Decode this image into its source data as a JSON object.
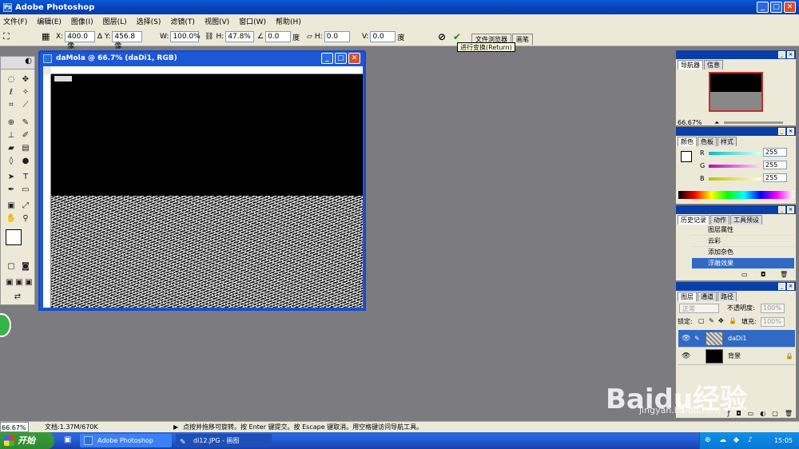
{
  "app": {
    "title": "Adobe Photoshop"
  },
  "menu": [
    "文件(F)",
    "编辑(E)",
    "图像(I)",
    "图层(L)",
    "选择(S)",
    "滤镜(T)",
    "视图(V)",
    "窗口(W)",
    "帮助(H)"
  ],
  "options": {
    "x_label": "X:",
    "x_value": "400.0 像",
    "y_label": "Y:",
    "y_value": "456.8 像",
    "w_label": "W:",
    "w_value": "100.0%",
    "h_label": "H:",
    "h_value": "47.8%",
    "angle_value": "0.0",
    "angle_unit": "度",
    "hskew_label": "H:",
    "hskew_value": "0.0",
    "vskew_label": "V:",
    "vskew_value": "0.0",
    "skew_unit": "度",
    "tooltip": "进行变换(Return)"
  },
  "palette_tabs": [
    "文件浏览器",
    "画笔"
  ],
  "document": {
    "title": "daMola @ 66.7% (daDi1, RGB)"
  },
  "navigator": {
    "tabs": [
      "导航器",
      "信息"
    ],
    "zoom": "66.67%"
  },
  "color": {
    "tabs": [
      "颜色",
      "色板",
      "样式"
    ],
    "channels": [
      {
        "label": "R",
        "value": "255",
        "color": "#00c0c0"
      },
      {
        "label": "G",
        "value": "255",
        "color": "#c000c0"
      },
      {
        "label": "B",
        "value": "255",
        "color": "#c0c000"
      }
    ]
  },
  "history": {
    "tabs": [
      "历史记录",
      "动作",
      "工具预设"
    ],
    "items": [
      "图层属性",
      "云彩",
      "添加杂色",
      "浮雕效果"
    ],
    "selected_index": 3
  },
  "layers": {
    "tabs": [
      "图层",
      "通道",
      "路径"
    ],
    "blend_mode": "正常",
    "opacity_label": "不透明度:",
    "opacity_value": "100%",
    "lock_label": "锁定:",
    "fill_label": "填充:",
    "fill_value": "100%",
    "items": [
      {
        "name": "daDi1",
        "selected": true
      },
      {
        "name": "背景",
        "selected": false
      }
    ]
  },
  "status": {
    "zoom": "66.67%",
    "doc": "文档:1.37M/670K",
    "hint": "点按并拖移可旋转。按 Enter 键提交。按 Escape 键取消。用空格键访问导航工具。"
  },
  "taskbar": {
    "start": "开始",
    "items": [
      "Adobe Photoshop",
      "di12.JPG - 画图"
    ],
    "time": "15:05"
  },
  "watermark": {
    "brand": "Baidu经验",
    "url": "jingyan.baidu.com"
  }
}
